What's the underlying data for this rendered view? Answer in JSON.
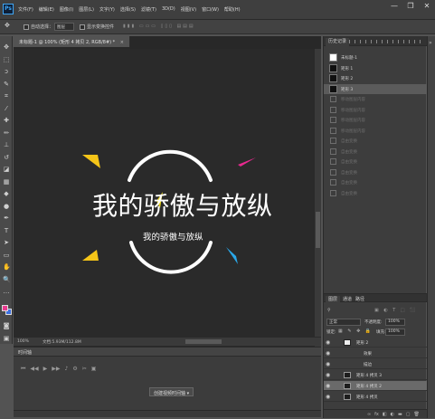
{
  "app": {
    "logo": "Ps"
  },
  "menu": [
    "文件(F)",
    "编辑(E)",
    "图像(I)",
    "图层(L)",
    "文字(Y)",
    "选择(S)",
    "滤镜(T)",
    "3D(D)",
    "视图(V)",
    "窗口(W)",
    "帮助(H)"
  ],
  "window_controls": {
    "minimize": "—",
    "restore": "❐",
    "close": "✕"
  },
  "options": {
    "auto_select_label": "自动选择：",
    "auto_select_value": "图层",
    "show_transform": "显示变换控件"
  },
  "document": {
    "tab_title": "未标题-1 @ 100% (矩形 4 拷贝 2, RGB/8#) *",
    "close_glyph": "×",
    "zoom": "100%",
    "doc_info": "文档:5.93M/112.8M"
  },
  "artwork": {
    "main_text": "我的骄傲与放纵",
    "sub_text": "我的骄傲与放纵",
    "colors": {
      "yellow": "#f5c518",
      "pink": "#e8298f",
      "blue": "#2aa7e8",
      "arc": "#ffffff"
    }
  },
  "timeline": {
    "title": "时间轴",
    "create_label": "创建视频时间轴"
  },
  "history": {
    "tabs": [
      "历史记录"
    ],
    "items": [
      {
        "label": "未标题-1",
        "state": "snapshot"
      },
      {
        "label": "矩形 1",
        "state": "normal"
      },
      {
        "label": "矩形 2",
        "state": "normal"
      },
      {
        "label": "矩形 3",
        "state": "selected"
      },
      {
        "label": "移动图层内容",
        "state": "dim"
      },
      {
        "label": "移动图层内容",
        "state": "dim"
      },
      {
        "label": "移动图层内容",
        "state": "dim"
      },
      {
        "label": "移动图层内容",
        "state": "dim"
      },
      {
        "label": "自由变换",
        "state": "dim"
      },
      {
        "label": "自由变换",
        "state": "dim"
      },
      {
        "label": "自由变换",
        "state": "dim"
      },
      {
        "label": "自由变换",
        "state": "dim"
      },
      {
        "label": "自由变换",
        "state": "dim"
      },
      {
        "label": "自由变换",
        "state": "dim"
      }
    ]
  },
  "layers": {
    "tabs": [
      "图层",
      "通道",
      "路径"
    ],
    "blend_mode": "正常",
    "opacity_label": "不透明度:",
    "opacity_value": "100%",
    "lock_label": "锁定:",
    "fill_label": "填充:",
    "fill_value": "100%",
    "rows": [
      {
        "name": "矩形 2",
        "thumb": "light",
        "selected": false
      },
      {
        "name": "效果",
        "thumb": "none",
        "selected": false
      },
      {
        "name": "描边",
        "thumb": "none",
        "selected": false
      },
      {
        "name": "矩形 4 拷贝 3",
        "thumb": "dark",
        "selected": false
      },
      {
        "name": "矩形 4 拷贝 2",
        "thumb": "dark",
        "selected": true
      },
      {
        "name": "矩形 4 拷贝",
        "thumb": "dark",
        "selected": false
      }
    ],
    "footer_icons": [
      "link-icon",
      "fx-icon",
      "mask-icon",
      "adjust-icon",
      "folder-icon",
      "new-layer-icon",
      "trash-icon"
    ]
  }
}
